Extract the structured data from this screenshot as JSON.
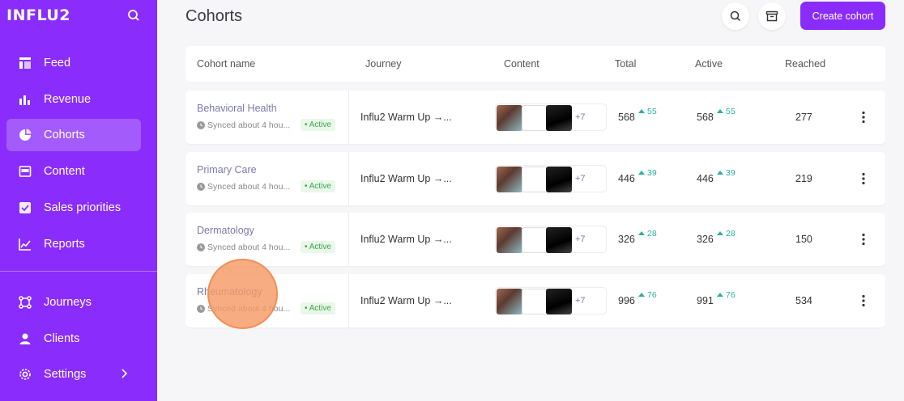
{
  "sidebar": {
    "brand": "INFLU2",
    "items": [
      {
        "label": "Feed",
        "icon": "feed-icon"
      },
      {
        "label": "Revenue",
        "icon": "bar-chart-icon"
      },
      {
        "label": "Cohorts",
        "icon": "pie-chart-icon",
        "active": true
      },
      {
        "label": "Content",
        "icon": "content-icon"
      },
      {
        "label": "Sales priorities",
        "icon": "checkbox-icon"
      },
      {
        "label": "Reports",
        "icon": "line-chart-icon"
      },
      {
        "label": "Journeys",
        "icon": "journeys-icon"
      },
      {
        "label": "Clients",
        "icon": "user-icon"
      },
      {
        "label": "Settings",
        "icon": "gear-icon"
      }
    ]
  },
  "header": {
    "title": "Cohorts",
    "create_label": "Create cohort"
  },
  "table": {
    "columns": [
      "Cohort name",
      "Journey",
      "Content",
      "Total",
      "Active",
      "Reached"
    ],
    "rows": [
      {
        "name": "Behavioral Health",
        "sync": "Synced about 4 hou...",
        "status": "• Active",
        "journey": "Influ2 Warm Up →...",
        "more": "+7",
        "total": "568",
        "total_delta": "55",
        "active": "568",
        "active_delta": "55",
        "reached": "277"
      },
      {
        "name": "Primary Care",
        "sync": "Synced about 4 hou...",
        "status": "• Active",
        "journey": "Influ2 Warm Up →...",
        "more": "+7",
        "total": "446",
        "total_delta": "39",
        "active": "446",
        "active_delta": "39",
        "reached": "219"
      },
      {
        "name": "Dermatology",
        "sync": "Synced about 4 hou...",
        "status": "• Active",
        "journey": "Influ2 Warm Up →...",
        "more": "+7",
        "total": "326",
        "total_delta": "28",
        "active": "326",
        "active_delta": "28",
        "reached": "150"
      },
      {
        "name": "Rheumatology",
        "sync": "Synced about 4 hou...",
        "status": "• Active",
        "journey": "Influ2 Warm Up →...",
        "more": "+7",
        "total": "996",
        "total_delta": "76",
        "active": "991",
        "active_delta": "76",
        "reached": "534"
      }
    ]
  },
  "colors": {
    "brand": "#8a2dfc",
    "active_badge": "#3aa84a",
    "delta": "#2bb0a0"
  }
}
